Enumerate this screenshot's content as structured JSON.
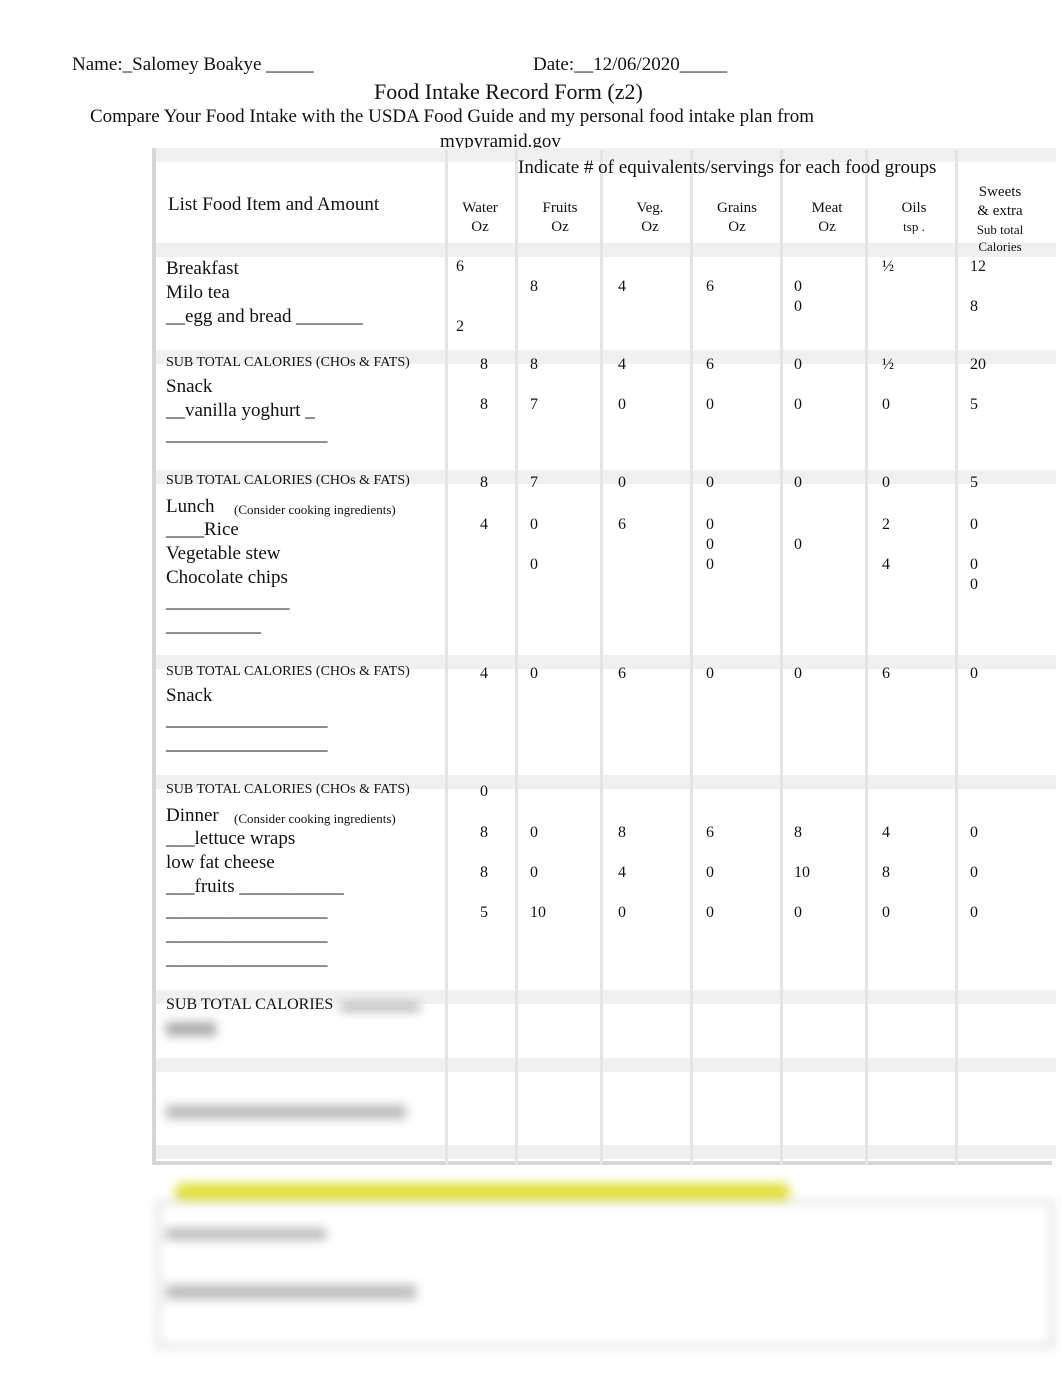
{
  "header": {
    "name": "Name:_Salomey Boakye _____",
    "date": "Date:__12/06/2020_____",
    "title": "Food Intake Record Form (z2)",
    "subtitle_1": "Compare Your Food Intake with the USDA Food Guide and my personal food intake plan from",
    "subtitle_2": "mypyramid.gov"
  },
  "table": {
    "group_header": "Indicate # of equivalents/servings for each food groups",
    "item_header": "List Food Item and Amount",
    "columns": [
      [
        "Water",
        "Oz"
      ],
      [
        "Fruits",
        "Oz"
      ],
      [
        "Veg.",
        "Oz"
      ],
      [
        "Grains",
        "Oz"
      ],
      [
        "Meat",
        "Oz"
      ],
      [
        "Oils",
        "tsp ."
      ],
      [
        "Sweets",
        "& extra",
        "Sub total",
        "Calories"
      ]
    ],
    "subtotal_label": "SUB TOTAL CALORIES (CHOs & FATS)",
    "final_subtotal_label": "SUB TOTAL CALORIES",
    "cooking_note": "(Consider cooking ingredients)",
    "meals": [
      {
        "title": "Breakfast",
        "lines": [
          "Milo tea",
          "__egg and bread _______"
        ],
        "values": [
          [
            "6",
            "",
            "",
            "2"
          ],
          [
            "",
            "8"
          ],
          [
            "",
            "4"
          ],
          [
            "",
            "6"
          ],
          [
            "",
            "0",
            "0"
          ],
          [
            "½"
          ],
          [
            "12",
            "",
            "8"
          ]
        ],
        "subtotal": [
          "8",
          "8",
          "4",
          "6",
          "0",
          "½",
          "20"
        ]
      },
      {
        "title": "Snack",
        "lines": [
          "__vanilla yoghurt _",
          "_________________"
        ],
        "values": [
          [
            "8"
          ],
          [
            "7"
          ],
          [
            "0"
          ],
          [
            "0"
          ],
          [
            "0"
          ],
          [
            "0"
          ],
          [
            "5"
          ]
        ],
        "subtotal": [
          "8",
          "7",
          "0",
          "0",
          "0",
          "0",
          "5"
        ]
      },
      {
        "title": "Lunch",
        "lines": [
          "____Rice",
          "Vegetable stew",
          "Chocolate chips",
          "_____________",
          "__________"
        ],
        "values": [
          [
            "4"
          ],
          [
            "0",
            "",
            "0"
          ],
          [
            "6"
          ],
          [
            "0",
            "0",
            "0"
          ],
          [
            "",
            "0"
          ],
          [
            "2",
            "",
            "4"
          ],
          [
            "0",
            "",
            "0",
            "0"
          ]
        ],
        "subtotal": [
          "4",
          "0",
          "6",
          "0",
          "0",
          "6",
          "0"
        ]
      },
      {
        "title": "Snack",
        "lines": [
          "_________________",
          "_________________"
        ],
        "values": [
          [],
          [],
          [],
          [],
          [],
          [],
          []
        ],
        "subtotal": [
          "0",
          "",
          "",
          "",
          "",
          "",
          ""
        ]
      },
      {
        "title": "Dinner",
        "lines": [
          "___lettuce wraps",
          " low fat cheese",
          " ___fruits ___________",
          "_________________",
          "_________________",
          "_________________"
        ],
        "values": [
          [
            "8",
            "",
            "8",
            "",
            "5"
          ],
          [
            "0",
            "",
            "0",
            "",
            "10"
          ],
          [
            "8",
            "",
            "4",
            "",
            "0"
          ],
          [
            "6",
            "",
            "0",
            "",
            "0"
          ],
          [
            "8",
            "",
            "10",
            "",
            "0"
          ],
          [
            "4",
            "",
            "8",
            "",
            "0"
          ],
          [
            "0",
            "",
            "0",
            "",
            "0"
          ]
        ]
      }
    ]
  },
  "colors": {
    "highlight": "#e8e83a",
    "grid": "#e0e0e0"
  }
}
